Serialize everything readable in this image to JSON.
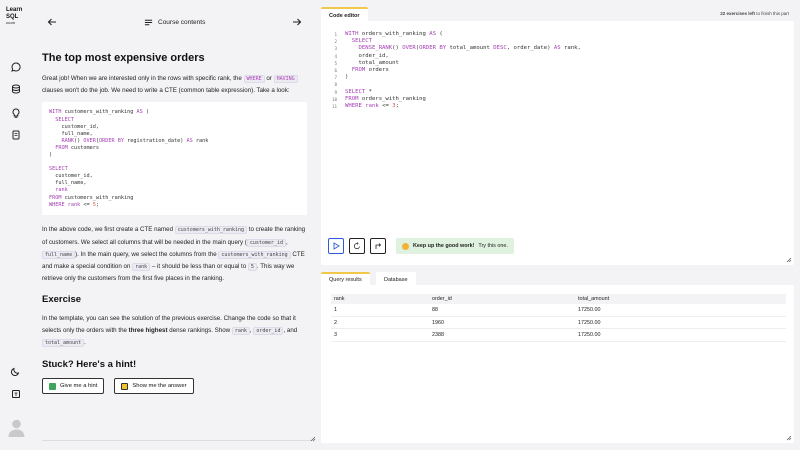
{
  "logo": {
    "line1": "Learn",
    "line2": "SQL",
    "line3": "•com"
  },
  "nav": {
    "title": "Course contents"
  },
  "lesson": {
    "title": "The top most expensive orders",
    "p1": {
      "a": "Great job! When we are interested only in the rows with specific rank, the ",
      "where": "WHERE",
      "b": " or ",
      "having": "HAVING",
      "c": " clauses won't do the job. We need to write a CTE (common table expression). Take a look:"
    },
    "code_example": "WITH customers_with_ranking AS (\n  SELECT\n    customer_id,\n    full_name,\n    RANK() OVER(ORDER BY registration_date) AS rank\n  FROM customers\n)\n\nSELECT\n  customer_id,\n  full_name,\n  rank\nFROM customers_with_ranking\nWHERE rank <= 5;",
    "p2": {
      "a": "In the above code, we first create a CTE named ",
      "cte": "customers_with_ranking",
      "b": " to create the ranking of customers. We select all columns that will be needed in the main query (",
      "col1": "customer_id",
      "c": ", ",
      "col2": "full_name",
      "d": "). In the main query, we select the columns from the ",
      "cte2": "customers_with_ranking",
      "e": " CTE and make a special condition on ",
      "rank": "rank",
      "f": " – it should be less than or equal to ",
      "five": "5",
      "g": ". This way we retrieve only the customers from the first five places in the ranking."
    },
    "exercise_title": "Exercise",
    "p3": {
      "a": "In the template, you can see the solution of the previous exercise. Change the code so that it selects only the orders with the ",
      "bold": "three highest",
      "b": " dense rankings. Show ",
      "rank": "rank",
      "c": ",",
      "order_id": "order_id",
      "d": ", and ",
      "total": "total_amount",
      "e": "."
    },
    "hint_title": "Stuck? Here's a hint!",
    "hint_button": "Give me a hint",
    "answer_button": "Show me the answer"
  },
  "editor": {
    "tab_label": "Code editor",
    "remaining_count": "22 exercises left",
    "remaining_suffix": " to finish this part",
    "line_numbers": [
      "1",
      "2",
      "3",
      "4",
      "5",
      "6",
      "7",
      "8",
      "9",
      "10",
      "11"
    ],
    "code": "WITH orders_with_ranking AS (\n  SELECT\n    DENSE_RANK() OVER(ORDER BY total_amount DESC, order_date) AS rank,\n    order_id,\n    total_amount\n  FROM orders\n)\n\nSELECT *\nFROM orders_with_ranking\nWHERE rank <= 3;",
    "toast_bold": "Keep up the good work!",
    "toast_rest": " Try this one."
  },
  "results": {
    "tab_results": "Query results",
    "tab_database": "Database",
    "headers": [
      "rank",
      "order_id",
      "total_amount"
    ],
    "rows": [
      [
        "1",
        "88",
        "17250.00"
      ],
      [
        "2",
        "1960",
        "17250.00"
      ],
      [
        "3",
        "2388",
        "17250.00"
      ]
    ]
  },
  "colors": {
    "accent_tab": "#f0c94a",
    "run_blue": "#2f5bd8",
    "keyword_purple": "#a43fb3",
    "toast_green": "#dff1df"
  },
  "icons": [
    "chat-icon",
    "database-icon",
    "lightbulb-icon",
    "notebook-icon",
    "moon-icon",
    "shortcut-icon",
    "user-avatar-icon",
    "arrow-left-icon",
    "arrow-right-icon",
    "list-icon",
    "play-icon",
    "reset-icon",
    "step-icon",
    "smile-icon",
    "resize-icon"
  ]
}
